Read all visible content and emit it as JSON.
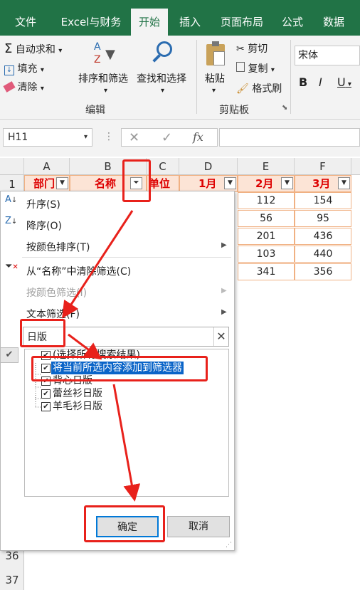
{
  "ribbon_tabs": [
    "文件",
    "Excel与财务",
    "开始",
    "插入",
    "页面布局",
    "公式",
    "数据"
  ],
  "ribbon": {
    "autosum": "自动求和",
    "fill": "填充",
    "clear": "清除",
    "sort_filter": "排序和筛选",
    "find_select": "查找和选择",
    "edit_group": "编辑",
    "paste": "粘贴",
    "cut": "剪切",
    "copy": "复制",
    "format_painter": "格式刷",
    "clipboard_group": "剪贴板",
    "font_name": "宋体",
    "bold": "B",
    "italic": "I",
    "underline": "U"
  },
  "formula_bar": {
    "name_box": "H11",
    "cancel": "✕",
    "confirm": "✓",
    "fx": "fx"
  },
  "columns": [
    "A",
    "B",
    "C",
    "D",
    "E",
    "F"
  ],
  "rows": [
    "1",
    "36",
    "37"
  ],
  "header_row": {
    "A": "部门",
    "B": "名称",
    "C": "单位",
    "D": "1月",
    "E": "2月",
    "F": "3月"
  },
  "data_rows": [
    {
      "E": "112",
      "F": "154"
    },
    {
      "E": "56",
      "F": "95"
    },
    {
      "E": "201",
      "F": "436"
    },
    {
      "E": "103",
      "F": "440"
    },
    {
      "E": "341",
      "F": "356"
    }
  ],
  "menu": {
    "sort_asc": "升序(S)",
    "sort_desc": "降序(O)",
    "sort_by_color": "按颜色排序(T)",
    "clear_filter": "从“名称”中清除筛选(C)",
    "filter_by_color": "按颜色筛选(I)",
    "text_filter": "文本筛选(F)",
    "search_value": "日版",
    "list_items": [
      {
        "label": "(选择所有搜索结果)",
        "checked": true
      },
      {
        "label": "将当前所选内容添加到筛选器",
        "checked": true
      },
      {
        "label": "背心日版",
        "checked": true
      },
      {
        "label": "蕾丝衫日版",
        "checked": true
      },
      {
        "label": "羊毛衫日版",
        "checked": true
      }
    ],
    "ok": "确定",
    "cancel": "取消"
  },
  "colors": {
    "excel_green": "#217346",
    "annotation_red": "#e8211b",
    "header_fill": "#fce4d6",
    "header_text": "#dd0000",
    "selection_blue": "#0a64c8"
  }
}
